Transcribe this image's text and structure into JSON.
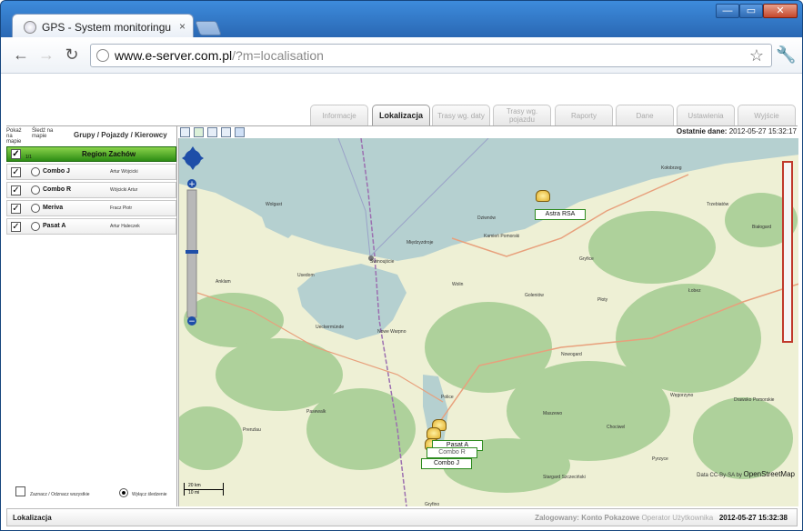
{
  "browser": {
    "tab_title": "GPS - System monitoringu",
    "tab_close": "×",
    "url_host": "www.e-server.com.pl",
    "url_path": "/?m=localisation",
    "back_label": "←",
    "forward_label": "→",
    "reload_label": "↻",
    "star_label": "☆",
    "wrench_label": "🔧",
    "minimize_label": "—",
    "maximize_label": "▭",
    "close_label": "✕"
  },
  "nav": {
    "tabs": [
      {
        "label": "Informacje",
        "active": false
      },
      {
        "label": "Lokalizacja",
        "active": true
      },
      {
        "label": "Trasy wg. daty",
        "active": false
      },
      {
        "label": "Trasy wg. pojazdu",
        "active": false
      },
      {
        "label": "Raporty",
        "active": false
      },
      {
        "label": "Dane",
        "active": false
      },
      {
        "label": "Ustawienia",
        "active": false
      },
      {
        "label": "Wyjście",
        "active": false
      }
    ]
  },
  "sidebar": {
    "col_show": "Pokaż na mapie",
    "col_follow": "Śledź na mapie",
    "col_groups": "Grupy / Pojazdy / Kierowcy",
    "region": {
      "count": "1/1",
      "name": "Region Zachów"
    },
    "vehicles": [
      {
        "name": "Combo J",
        "driver": "Artur Wójcicki"
      },
      {
        "name": "Combo R",
        "driver": "Wójcicki Artur"
      },
      {
        "name": "Meriva",
        "driver": "Fracz Piotr"
      },
      {
        "name": "Pasat A",
        "driver": "Artur Haleczek"
      }
    ],
    "select_all": "Zaznacz / Odznacz wszystkie",
    "disable_tracking": "Wyłącz śledzenie"
  },
  "map": {
    "last_data_label": "Ostatnie dane:",
    "last_data_value": "2012-05-27 15:32:17",
    "attribution": "Data CC-By-SA by",
    "attribution_link": "OpenStreetMap",
    "scale_km": "20 km",
    "scale_mi": "10 mi",
    "vehicle_labels": [
      {
        "text": "Astra RSA"
      },
      {
        "text": "Pasat A"
      },
      {
        "text": "Combo R"
      },
      {
        "text": "Combo J"
      }
    ],
    "places": [
      "Kołobrzeg",
      "Trzebiatów",
      "Białogard",
      "Gryfice",
      "Płoty",
      "Goleniów",
      "Nowogard",
      "Świnoujście",
      "Międzyzdroje",
      "Kamień Pomorski",
      "Wolin",
      "Dziwnów",
      "Ueckermünde",
      "Nowe Warpno",
      "Police",
      "Maszewo",
      "Chociwel",
      "Stargard Szczeciński",
      "Pasewalk",
      "Prenzlau",
      "Gryfino",
      "Wolgast",
      "Anklam",
      "Usedom",
      "Łobez",
      "Drawsko Pomorskie",
      "Węgorzyno",
      "Pyrzyce"
    ],
    "colors": {
      "water": "#b5d0d0",
      "land": "#eef0d5",
      "forest": "#aed19b",
      "accent": "#2c8a1e"
    }
  },
  "status": {
    "left": "Lokalizacja",
    "logged_label": "Zalogowany:",
    "account": "Konto Pokazowe",
    "role": "Operator",
    "role2": "Użytkownika",
    "time": "2012-05-27 15:32:38"
  }
}
